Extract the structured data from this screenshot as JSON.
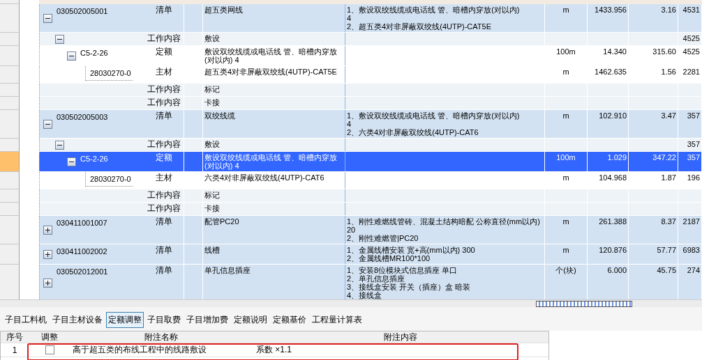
{
  "rows": [
    {
      "kind": "list",
      "code": "030502005001",
      "type": "清单",
      "name": "超五类网线",
      "feature": "1、敷设双绞线缆或电话线 管、暗槽内穿放(对以内)\n4\n2、超五类4对非屏蔽双绞线(4UTP)-CAT5E",
      "unit": "m",
      "qty": "1433.956",
      "price": "3.16",
      "total": "4531",
      "expanded": true,
      "selected": false,
      "children": [
        {
          "kind": "work",
          "type": "工作内容",
          "name": "敷设",
          "total": "4525",
          "expanded": true,
          "selected": false,
          "children": [
            {
              "kind": "quota",
              "code": "C5-2-26",
              "type": "定额",
              "name": "敷设双绞线缆或电话线 管、暗槽内穿放(对以内) 4",
              "unit": "100m",
              "qty": "14.340",
              "price": "315.60",
              "total": "4525",
              "expanded": true,
              "selected": false,
              "children": [
                {
                  "kind": "material",
                  "code": "28030270-0",
                  "type": "主材",
                  "name": "超五类4对非屏蔽双绞线(4UTP)-CAT5E",
                  "unit": "m",
                  "qty": "1462.635",
                  "price": "1.56",
                  "total": "2281",
                  "selected": false
                }
              ]
            }
          ]
        },
        {
          "kind": "work",
          "type": "工作内容",
          "name": "标记",
          "selected": false
        },
        {
          "kind": "work",
          "type": "工作内容",
          "name": "卡接",
          "selected": false
        }
      ]
    },
    {
      "kind": "list",
      "code": "030502005003",
      "type": "清单",
      "name": "双绞线缆",
      "feature": "1、敷设双绞线缆或电话线 管、暗槽内穿放(对以内)\n4\n2、六类4对非屏蔽双绞线(4UTP)-CAT6",
      "unit": "m",
      "qty": "102.910",
      "price": "3.47",
      "total": "357",
      "expanded": true,
      "selected": false,
      "children": [
        {
          "kind": "work",
          "type": "工作内容",
          "name": "敷设",
          "total": "357",
          "expanded": true,
          "selected": false,
          "children": [
            {
              "kind": "quota",
              "code": "C5-2-26",
              "type": "定额",
              "name": "敷设双绞线缆或电话线 管、暗槽内穿放(对以内) 4",
              "unit": "100m",
              "qty": "1.029",
              "price": "347.22",
              "total": "357",
              "expanded": true,
              "selected": true,
              "children": [
                {
                  "kind": "material",
                  "code": "28030270-0",
                  "type": "主材",
                  "name": "六类4对非屏蔽双绞线(4UTP)-CAT6",
                  "unit": "m",
                  "qty": "104.968",
                  "price": "1.87",
                  "total": "196",
                  "selected": false
                }
              ]
            }
          ]
        },
        {
          "kind": "work",
          "type": "工作内容",
          "name": "标记",
          "selected": false
        },
        {
          "kind": "work",
          "type": "工作内容",
          "name": "卡接",
          "selected": false
        }
      ]
    },
    {
      "kind": "list",
      "code": "030411001007",
      "type": "清单",
      "name": "配管PC20",
      "feature": "1、刚性难燃线管砖、混凝土结构暗配 公称直径(mm以内) 20\n2、刚性难燃管|PC20",
      "unit": "m",
      "qty": "261.388",
      "price": "8.37",
      "total": "2187",
      "expanded": false,
      "selected": false
    },
    {
      "kind": "list",
      "code": "030411002002",
      "type": "清单",
      "name": "线槽",
      "feature": "1、金属线槽安装 宽+高(mm以内) 300\n2、金属线槽MR100*100",
      "unit": "m",
      "qty": "120.876",
      "price": "57.77",
      "total": "6983",
      "expanded": false,
      "selected": false
    },
    {
      "kind": "list",
      "code": "030502012001",
      "type": "清单",
      "name": "单孔信息插座",
      "feature": "1、安装8位模块式信息插座 单口\n2、单孔信息插座\n3、接线盒安装 开关（插座）盒 暗装\n4、接线盒",
      "unit": "个(块)",
      "qty": "6.000",
      "price": "45.75",
      "total": "274",
      "expanded": false,
      "selected": false
    }
  ],
  "tabs": [
    {
      "label": "子目工料机",
      "selected": false
    },
    {
      "label": "子目主材设备",
      "selected": false
    },
    {
      "label": "定额调整",
      "selected": true
    },
    {
      "label": "子目取费",
      "selected": false
    },
    {
      "label": "子目增加费",
      "selected": false
    },
    {
      "label": "定额说明",
      "selected": false
    },
    {
      "label": "定额基价",
      "selected": false
    },
    {
      "label": "工程量计算表",
      "selected": false
    }
  ],
  "notes": {
    "columns": [
      "序号",
      "调整",
      "附注名称",
      "附注内容"
    ],
    "rows": [
      {
        "no": "1",
        "checked": false,
        "name": "高于超五类的布线工程中的线路敷设",
        "content": "系数 ×1.1"
      }
    ]
  }
}
